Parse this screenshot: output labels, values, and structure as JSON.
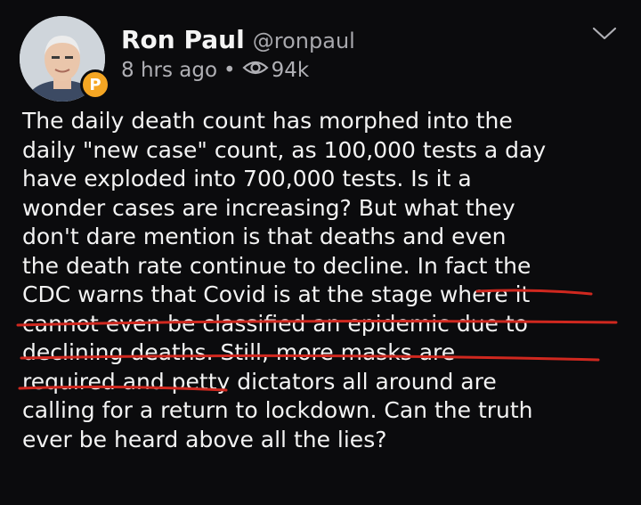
{
  "author": {
    "display_name": "Ron Paul",
    "handle": "@ronpaul",
    "badge_letter": "P"
  },
  "meta": {
    "time_ago": "8 hrs ago",
    "separator": "•",
    "views": "94k"
  },
  "post": {
    "text": "The daily death count has morphed into the\ndaily \"new case\" count, as 100,000 tests a day\nhave exploded into 700,000 tests. Is it a\nwonder cases are increasing? But what they\ndon't dare mention is that deaths and even\nthe death rate continue to decline. In fact the\nCDC warns that Covid is at the stage where it\ncannot even be classified an epidemic due to\ndeclining deaths. Still, more masks are\nrequired and petty dictators all around are\ncalling for a return to lockdown. Can the truth\never be heard above all the lies?"
  },
  "colors": {
    "background": "#0b0b0d",
    "text": "#f3f3f3",
    "muted": "#b0b0b5",
    "badge": "#f5a623",
    "underline_marker": "#d0281f"
  },
  "icons": {
    "views": "eye-icon",
    "menu": "chevron-down-icon",
    "badge": "premium-badge-icon"
  }
}
